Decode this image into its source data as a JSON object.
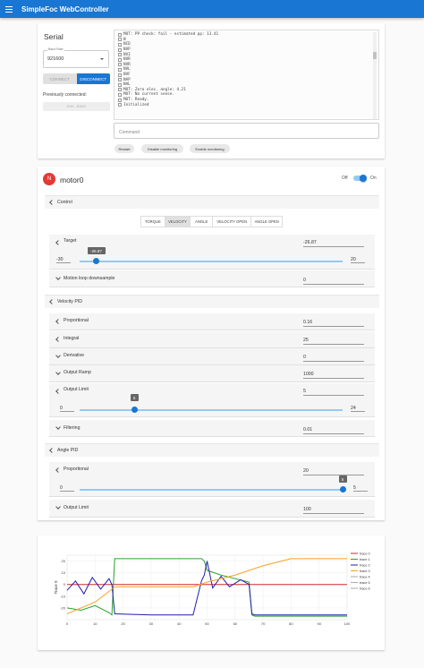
{
  "appbar": {
    "title": "SimpleFoc WebController"
  },
  "serial": {
    "title": "Serial",
    "baud_label": "Baud Rate",
    "baud_value": "921600",
    "connect_label": "CONNECT",
    "disconnect_label": "DISCONNECT",
    "previously_connected_label": "Previously connected:",
    "previous_port": "6790 - 2DD67",
    "console_lines": [
      "MOT: PP check: fail - estimated pp: 13.41",
      "N",
      "NCD",
      "NVP",
      "NVI",
      "NVR",
      "NVR",
      "NVL",
      "NVF",
      "NAP",
      "NAL",
      "MOT: Zero elec. angle: 4.21",
      "MOT: No current sense.",
      "MOT: Ready.",
      "Initialized"
    ],
    "command_placeholder": "Command",
    "actions": [
      "Restart",
      "Disable monitoring",
      "Enable monitoring"
    ]
  },
  "motor": {
    "avatar_letter": "N",
    "name": "motor0",
    "off_label": "Off",
    "on_label": "On",
    "enabled": true,
    "control": {
      "title": "Control",
      "tabs": [
        "TORQUE",
        "VELOCITY",
        "ANGLE",
        "VELOCITY OPEN",
        "ANGLE OPEN"
      ],
      "active_tab": "VELOCITY",
      "target_label": "Target",
      "target_value": "-26.87",
      "target_min": "-30",
      "target_max": "20",
      "target_fraction": 0.063,
      "downsample_label": "Motion loop downsample",
      "downsample_value": "0"
    },
    "velocity_pid": {
      "title": "Velocity PID",
      "proportional_label": "Proportional",
      "proportional_value": "0.16",
      "integral_label": "Integral",
      "integral_value": "25",
      "derivative_label": "Derivative",
      "derivative_value": "0",
      "ramp_label": "Output Ramp",
      "ramp_value": "1000",
      "limit_label": "Output Limit",
      "limit_value": "5",
      "limit_min": "0",
      "limit_max": "24",
      "limit_fraction": 0.208,
      "filtering_label": "Filtering",
      "filtering_value": "0.01"
    },
    "angle_pid": {
      "title": "Angle PID",
      "proportional_label": "Proportional",
      "proportional_value": "20",
      "p_min": "0",
      "p_max": "5",
      "p_fraction": 1.0,
      "limit_label": "Output Limit",
      "limit_value": "100"
    }
  },
  "chart_data": {
    "type": "line",
    "ylabel": "Trace 9",
    "xlim": [
      0,
      100
    ],
    "ylim": [
      -30,
      25
    ],
    "x_ticks": [
      "0",
      "10",
      "20",
      "30",
      "40",
      "50",
      "60",
      "70",
      "80",
      "90",
      "100"
    ],
    "y_ticks": [
      "20",
      "10",
      "0",
      "-10",
      "-20"
    ],
    "series": [
      {
        "name": "trace 0",
        "color": "#d62728",
        "x": [
          0,
          100
        ],
        "y": [
          0,
          0
        ]
      },
      {
        "name": "trace 1",
        "color": "#2ca02c",
        "x": [
          0,
          5,
          10,
          15,
          16,
          17,
          48,
          49,
          50,
          55,
          60,
          65,
          66,
          67,
          100
        ],
        "y": [
          -20,
          -22,
          -18,
          -24,
          -26,
          22,
          22,
          20,
          12,
          8,
          5,
          2,
          -26,
          -27,
          -27
        ]
      },
      {
        "name": "trace 2",
        "color": "#1f1fb4",
        "x": [
          0,
          3,
          6,
          9,
          12,
          15,
          16,
          17,
          30,
          45,
          48,
          49,
          50,
          52,
          55,
          58,
          62,
          65,
          66,
          67,
          80,
          100
        ],
        "y": [
          -5,
          3,
          -8,
          6,
          -4,
          5,
          0,
          -25,
          -26,
          -26,
          3,
          8,
          20,
          -3,
          7,
          -2,
          4,
          0,
          -25,
          -26,
          -26,
          -26
        ]
      },
      {
        "name": "trace 3",
        "color": "#ff9f1c",
        "x": [
          0,
          5,
          10,
          16,
          17,
          30,
          45,
          50,
          60,
          70,
          80,
          90,
          100
        ],
        "y": [
          -25,
          -20,
          -15,
          -4,
          -2,
          -2,
          -2,
          2,
          8,
          16,
          22,
          22,
          22
        ]
      },
      {
        "name": "trace 4",
        "color": "#aaaaaa",
        "x": [],
        "y": []
      },
      {
        "name": "trace 5",
        "color": "#aaaaaa",
        "x": [],
        "y": []
      },
      {
        "name": "trace 6",
        "color": "#aaaaaa",
        "x": [],
        "y": []
      }
    ]
  }
}
